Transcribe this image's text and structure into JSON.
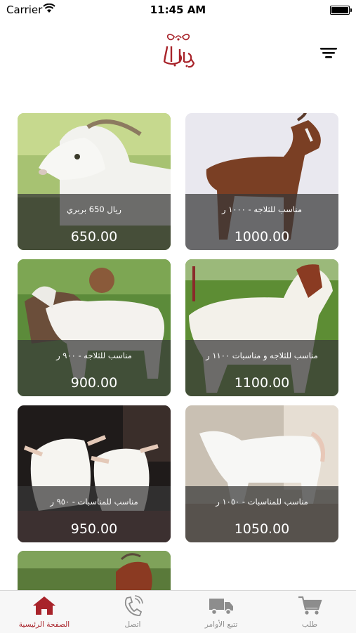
{
  "status_bar": {
    "carrier": "Carrier",
    "time": "11:45 AM"
  },
  "header": {
    "logo_text": "الجابري"
  },
  "products": [
    {
      "description": "ريال  650  بربري",
      "price": "650.00"
    },
    {
      "description": "مناسب للثلاجه - ١٠٠٠ ر",
      "price": "1000.00"
    },
    {
      "description": "مناسب للثلاجه - ٩٠٠ ر",
      "price": "900.00"
    },
    {
      "description": "مناسب للثلاجه و مناسبات ١١٠٠ ر",
      "price": "1100.00"
    },
    {
      "description": "مناسب للمناسبات - ٩٥٠ ر",
      "price": "950.00"
    },
    {
      "description": "مناسب للمناسبات - ١٠٥٠ ر",
      "price": "1050.00"
    }
  ],
  "tab_bar": {
    "tabs": [
      {
        "label": "الصفحة الرئيسية",
        "icon": "home-icon",
        "active": true
      },
      {
        "label": "اتصل",
        "icon": "phone-icon",
        "active": false
      },
      {
        "label": "تتبع الأوامر",
        "icon": "truck-icon",
        "active": false
      },
      {
        "label": "طلب",
        "icon": "cart-icon",
        "active": false
      }
    ]
  },
  "colors": {
    "accent": "#a8232a",
    "inactive": "#8d8d8d",
    "overlay": "#373737"
  }
}
